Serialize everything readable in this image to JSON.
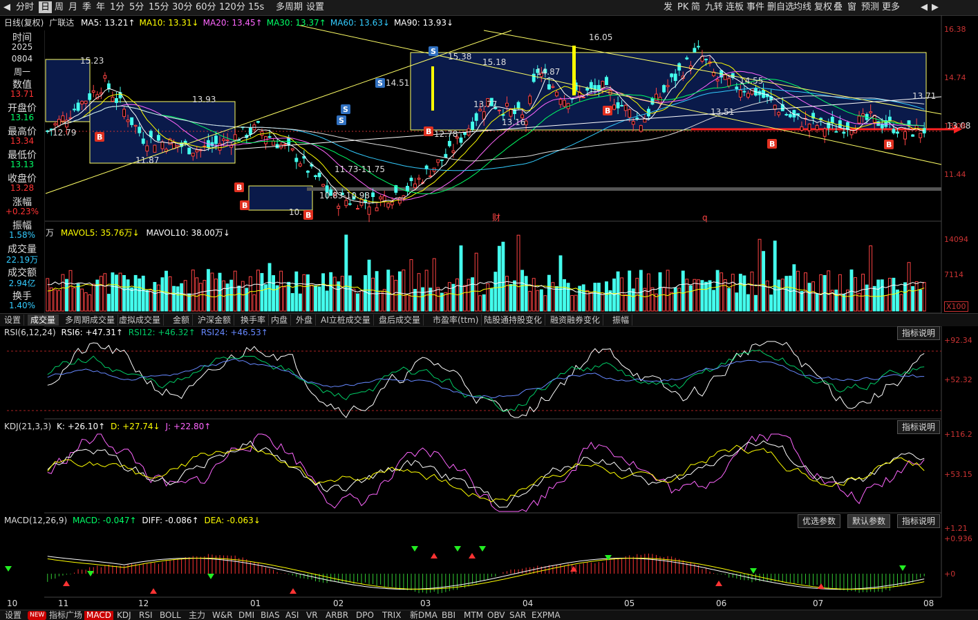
{
  "toolbar": {
    "left": [
      "分时",
      "日",
      "周",
      "月",
      "季",
      "年",
      "1分",
      "5分",
      "15分",
      "30分",
      "60分",
      "120分",
      "15s",
      "多周期",
      "设置"
    ],
    "active": "日",
    "right": [
      "发",
      "PK",
      "简",
      "九转",
      "连板",
      "事件",
      "删自选",
      "均线",
      "复权",
      "叠",
      "窗",
      "预测",
      "更多"
    ]
  },
  "header": {
    "title": "日线(复权)",
    "stock": "广联达",
    "ma": [
      {
        "label": "MA5: 13.21↑",
        "color": "#ffffff"
      },
      {
        "label": "MA10: 13.31↓",
        "color": "#ffff00"
      },
      {
        "label": "MA20: 13.45↑",
        "color": "#ff66ff"
      },
      {
        "label": "MA30: 13.37↑",
        "color": "#00ff66"
      },
      {
        "label": "MA60: 13.63↓",
        "color": "#33ccff"
      },
      {
        "label": "MA90: 13.93↓",
        "color": "#ffffff"
      }
    ]
  },
  "info": [
    {
      "label": "时间",
      "value": "2025\n0804\n周一",
      "color": "#dddddd"
    },
    {
      "label": "数值",
      "value": "13.71",
      "color": "#ff3333"
    },
    {
      "label": "开盘价",
      "value": "13.16",
      "color": "#00ff66"
    },
    {
      "label": "最高价",
      "value": "13.34",
      "color": "#ff3333"
    },
    {
      "label": "最低价",
      "value": "13.13",
      "color": "#00ff66"
    },
    {
      "label": "收盘价",
      "value": "13.28",
      "color": "#ff3333"
    },
    {
      "label": "涨幅",
      "value": "+0.23%",
      "color": "#ff3333"
    },
    {
      "label": "振幅",
      "value": "1.58%",
      "color": "#33ccff"
    },
    {
      "label": "成交量",
      "value": "22.19万",
      "color": "#33ccff"
    },
    {
      "label": "成交额",
      "value": "2.94亿",
      "color": "#33ccff"
    },
    {
      "label": "换手",
      "value": "1.40%",
      "color": "#33ccff"
    }
  ],
  "price_axis": [
    "16.38",
    "14.74",
    "13.08",
    "11.44"
  ],
  "annotations": [
    "16.05",
    "15.38",
    "15.18",
    "15.23",
    "14.87",
    "14.55",
    "14.51",
    "13.93",
    "13.77",
    "13.71",
    "13.51",
    "13.16",
    "13.08",
    "12.79",
    "12.78",
    "11.87",
    "11.73-11.75",
    "10.83-10.98",
    "10.",
    "财",
    "q"
  ],
  "volume": {
    "legend": "万",
    "mavol5": "MAVOL5: 35.76万↓",
    "mavol10": "MAVOL10: 38.00万↓",
    "axis": [
      "14094",
      "7114",
      "X100"
    ]
  },
  "tabs1": [
    "设置",
    "成交量",
    "多周期成交量",
    "虚拟成交量",
    "金额",
    "沪深金额",
    "换手率",
    "内盘",
    "外盘",
    "AI立桩成交量",
    "盘后成交量",
    "市盈率(ttm)",
    "陆股通持股变化",
    "融资融券变化",
    "振幅"
  ],
  "tabs1_active": "成交量",
  "rsi": {
    "title": "RSI(6,12,24)",
    "r6": "RSI6: +47.31↑",
    "r12": "RSI12: +46.32↑",
    "r24": "RSI24: +46.53↑",
    "axis": [
      "+92.34",
      "+52.32"
    ],
    "explain": "指标说明"
  },
  "kdj": {
    "title": "KDJ(21,3,3)",
    "k": "K: +26.10↑",
    "d": "D: +27.74↓",
    "j": "J: +22.80↑",
    "axis": [
      "+116.2",
      "+53.15"
    ],
    "explain": "指标说明"
  },
  "macd": {
    "title": "MACD(12,26,9)",
    "macd": "MACD: -0.047↑",
    "diff": "DIFF: -0.086↑",
    "dea": "DEA: -0.063↓",
    "axis": [
      "+1.21",
      "+0.936",
      "+0"
    ],
    "opt": "优选参数",
    "def": "默认参数",
    "explain": "指标说明"
  },
  "xaxis": [
    "10",
    "11",
    "12",
    "01",
    "02",
    "03",
    "04",
    "05",
    "06",
    "07",
    "08"
  ],
  "bottom_tabs": [
    "设置",
    "NEW",
    "指标广场",
    "MACD",
    "KDJ",
    "RSI",
    "BOLL",
    "主力",
    "W&R",
    "DMI",
    "BIAS",
    "ASI",
    "VR",
    "ARBR",
    "DPO",
    "TRIX",
    "新DMA",
    "BBI",
    "MTM",
    "OBV",
    "SAR",
    "EXPMA"
  ],
  "bottom_active": "MACD",
  "chart_data": {
    "type": "candlestick",
    "ylim": [
      10.5,
      16.5
    ],
    "key_points": {
      "high": 16.05,
      "low": 10.83,
      "last_close": 13.28
    },
    "price_axis": [
      16.38,
      14.74,
      13.08,
      11.44
    ]
  }
}
